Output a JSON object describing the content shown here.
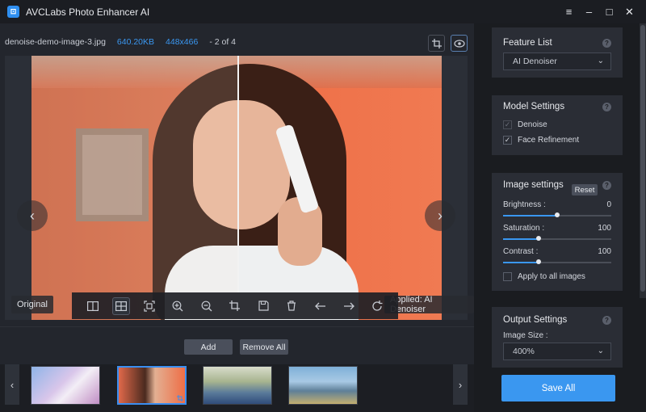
{
  "app": {
    "title": "AVCLabs Photo Enhancer AI",
    "logo_glyph": "⊡"
  },
  "window_controls": [
    "≡",
    "–",
    "□",
    "✕"
  ],
  "file": {
    "name": "denoise-demo-image-3.jpg",
    "size": "640.20KB",
    "dimensions": "448x466",
    "position": "- 2 of 4"
  },
  "preview": {
    "left_label": "Original",
    "right_label": "Applied: AI Denoiser",
    "split_position": 0.5
  },
  "toolbar": {
    "icons": [
      "compare-icon",
      "split-view-icon",
      "fit-screen-icon",
      "zoom-in-icon",
      "zoom-out-icon",
      "crop-icon",
      "save-icon",
      "delete-icon",
      "arrow-left-icon",
      "arrow-right-icon",
      "rotate-icon"
    ]
  },
  "thumbs": {
    "add_label": "Add",
    "remove_all_label": "Remove All"
  },
  "panel": {
    "feature_list": {
      "title": "Feature List",
      "selected": "AI Denoiser"
    },
    "model_settings": {
      "title": "Model Settings",
      "options": [
        {
          "label": "Denoise",
          "checked": true
        },
        {
          "label": "Face Refinement",
          "checked": true
        }
      ]
    },
    "image_settings": {
      "title": "Image settings",
      "reset_label": "Reset",
      "brightness": {
        "label": "Brightness :",
        "value": "0",
        "level": 0.5
      },
      "saturation": {
        "label": "Saturation :",
        "value": "100",
        "level": 0.33
      },
      "contrast": {
        "label": "Contrast :",
        "value": "100",
        "level": 0.33
      },
      "apply_all_label": "Apply to all images"
    },
    "output_settings": {
      "title": "Output Settings",
      "image_size_label": "Image Size :",
      "image_size": "400%"
    },
    "save_all_label": "Save All"
  },
  "colors": {
    "accent": "#3a97f0",
    "panel_bg": "#2a2d35",
    "app_bg": "#1f2229"
  }
}
